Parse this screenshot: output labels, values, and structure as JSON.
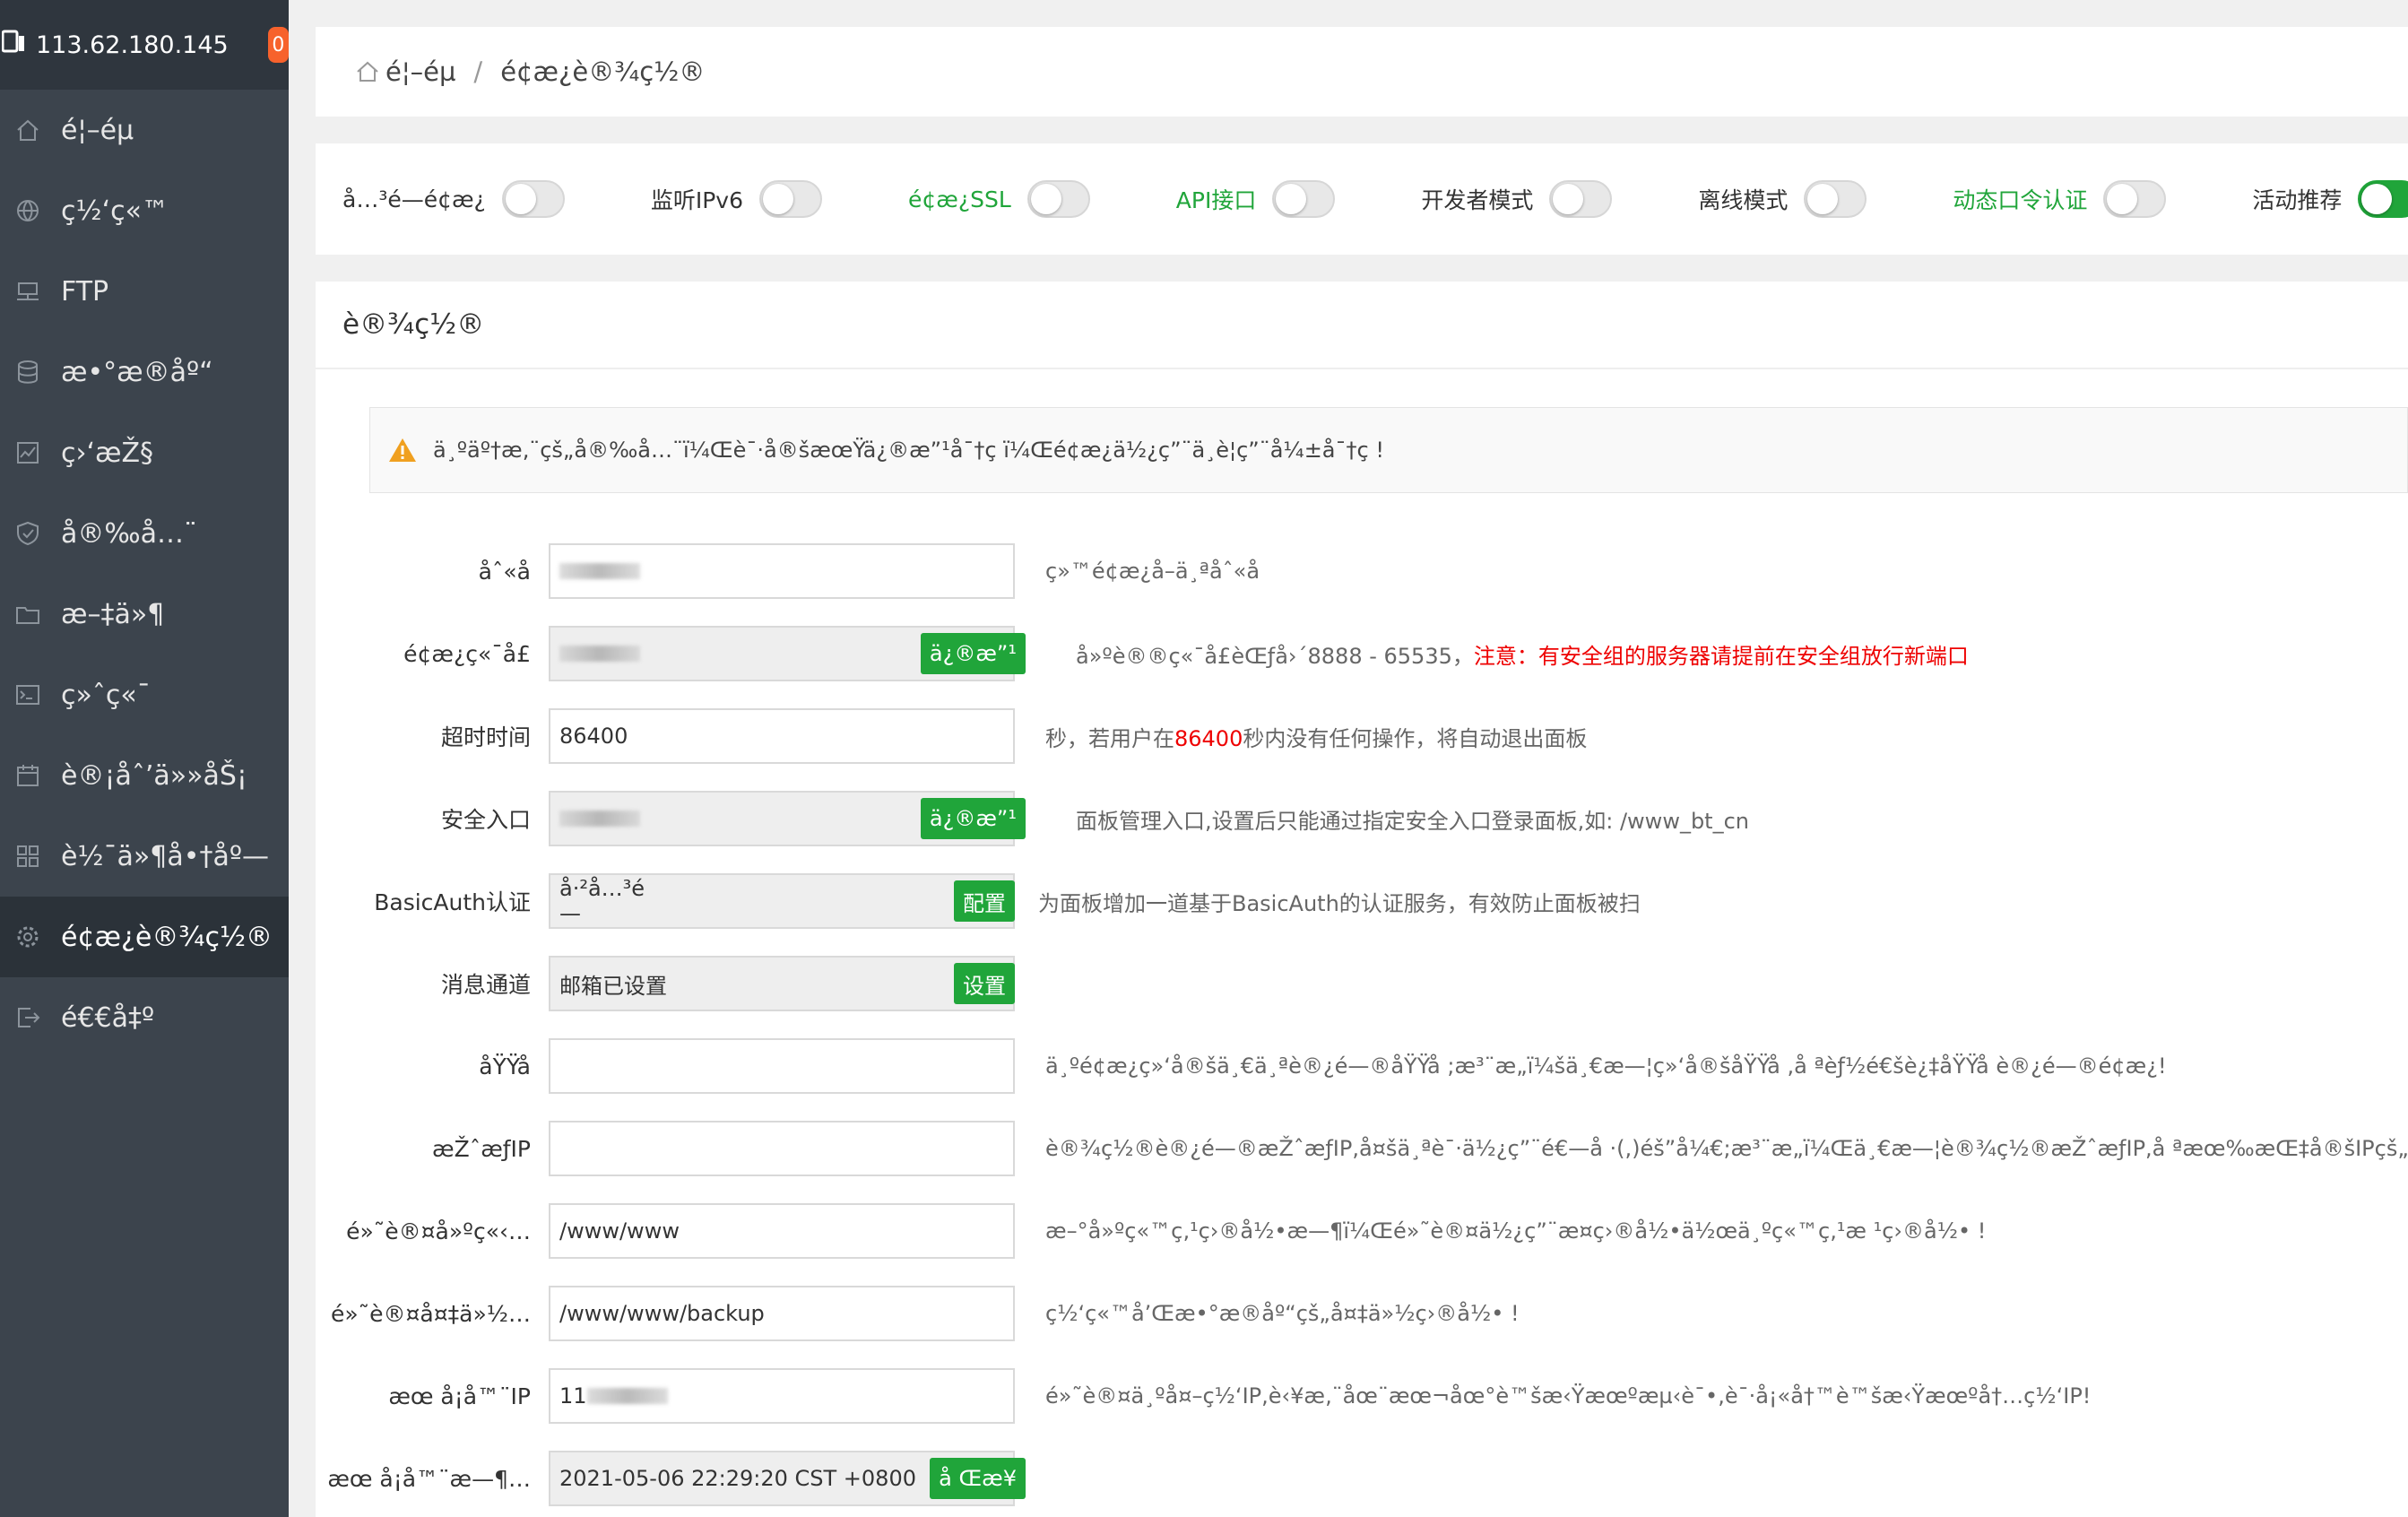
{
  "sidebar": {
    "server_ip": "113.62.180.145",
    "badge_count": "0",
    "items": [
      {
        "label": "é¦–éµ",
        "icon": "home-icon"
      },
      {
        "label": "ç½‘ç«™",
        "icon": "globe-icon"
      },
      {
        "label": "FTP",
        "icon": "ftp-icon"
      },
      {
        "label": "æ•°æ®åº“",
        "icon": "database-icon"
      },
      {
        "label": "ç›‘æŽ§",
        "icon": "monitor-icon"
      },
      {
        "label": "å®‰å…¨",
        "icon": "shield-icon"
      },
      {
        "label": "æ–‡ä»¶",
        "icon": "folder-icon"
      },
      {
        "label": "ç»ˆç«¯",
        "icon": "terminal-icon"
      },
      {
        "label": "è®¡åˆ’ä»»åŠ¡",
        "icon": "calendar-icon"
      },
      {
        "label": "è½¯ä»¶å•†åº—",
        "icon": "apps-icon"
      },
      {
        "label": "é¢æ¿è®¾ç½®",
        "icon": "gear-icon"
      },
      {
        "label": "é€€å‡º",
        "icon": "logout-icon"
      }
    ],
    "active_index": 10
  },
  "breadcrumb": {
    "home": "é¦–éµ",
    "separator": "/",
    "current": "é¢æ¿è®¾ç½®"
  },
  "toggles": [
    {
      "label": "å…³é—­é¢æ¿",
      "on": false,
      "green": false
    },
    {
      "label": "监听IPv6",
      "on": false,
      "green": false
    },
    {
      "label": "é¢æ¿SSL",
      "on": false,
      "green": true
    },
    {
      "label": "API接口",
      "on": false,
      "green": true
    },
    {
      "label": "开发者模式",
      "on": false,
      "green": false
    },
    {
      "label": "离线模式",
      "on": false,
      "green": false
    },
    {
      "label": "动态口令认证",
      "on": false,
      "green": true
    },
    {
      "label": "活动推荐",
      "on": true,
      "green": false
    }
  ],
  "settings": {
    "title": "è®¾ç½®",
    "warning": "ä¸ºäº†æ‚¨çš„å®‰å…¨ï¼Œè¯·å®šæœŸä¿®æ”¹å¯†ç ï¼Œé¢æ¿ä½¿ç”¨ä¸è¦ç”¨å¼±å¯†ç !",
    "fields": [
      {
        "label": "åˆ«å",
        "value": "",
        "hint": "ç»™é¢æ¿å–ä¸ªåˆ«å"
      },
      {
        "label": "é¢æ¿ç«¯å£",
        "value": "",
        "button": "ä¿®æ”¹",
        "hint": "å»ºè®®ç«¯å£èŒƒå›´8888 - 65535，",
        "hint_red": "注意：有安全组的服务器请提前在安全组放行新端口"
      },
      {
        "label": "超时时间",
        "value": "86400",
        "hint_prefix": "秒，若用户在",
        "hint_red": "86400",
        "hint": "秒内没有任何操作，将自动退出面板"
      },
      {
        "label": "安全入口",
        "value": "",
        "button": "ä¿®æ”¹",
        "hint": "面板管理入口,设置后只能通过指定安全入口登录面板,如: /www_bt_cn"
      },
      {
        "label": "BasicAuth认证",
        "value": "å·²å…³é—­",
        "button": "配置",
        "hint": "为面板增加一道基于BasicAuth的认证服务，有效防止面板被扫"
      },
      {
        "label": "消息通道",
        "value": "邮箱已设置",
        "button": "设置",
        "hint": ""
      },
      {
        "label": "åŸŸå",
        "value": "",
        "hint": "ä¸ºé¢æ¿ç»‘å®šä¸€ä¸ªè®¿é—®åŸŸå ;æ³¨æ„ï¼šä¸€æ—¦ç»‘å®šåŸŸå ,å ªèƒ½é€šè¿‡åŸŸå è®¿é—®é¢æ¿!"
      },
      {
        "label": "æŽˆæƒIP",
        "value": "",
        "hint": "è®¾ç½®è®¿é—®æŽˆæƒIP,å¤šä¸ªè¯·ä½¿ç”¨é€—å ·(,)éš”å¼€;æ³¨æ„ï¼Œä¸€æ—¦è®¾ç½®æŽˆæƒIP,å ªæœ‰æŒ‡å®šIPçš„ç”µè„‘èƒ½"
      },
      {
        "label": "é»˜è®¤å»ºç«‹…",
        "value": "/www/www",
        "hint": "æ–°å»ºç«™ç‚¹ç›®å½•æ—¶ï¼Œé»˜è®¤ä½¿ç”¨æ­¤ç›®å½•ä½œä¸ºç«™ç‚¹æ ¹ç›®å½• !"
      },
      {
        "label": "é»˜è®¤å¤‡ä»½…",
        "value": "/www/www/backup",
        "hint": "ç½‘ç«™å’Œæ•°æ®åº“çš„å¤‡ä»½ç›®å½• !"
      },
      {
        "label": "æœ å¡å™¨IP",
        "value": "11",
        "hint": "é»˜è®¤ä¸ºå¤–ç½‘IP,è‹¥æ‚¨åœ¨æœ¬åœ°è™šæ‹Ÿæœºæµ‹è¯•,è¯·å¡«å†™è™šæ‹Ÿæœºå†…ç½‘IP!"
      },
      {
        "label": "æœ å¡å™¨æ—¶…",
        "value": "2021-05-06 22:29:20 CST +0800",
        "button": "å Œæ­¥",
        "hint": ""
      }
    ]
  },
  "colors": {
    "accent": "#20a53a",
    "sidebar": "#3c444d",
    "danger": "#e00000",
    "badge": "#f7622c"
  }
}
